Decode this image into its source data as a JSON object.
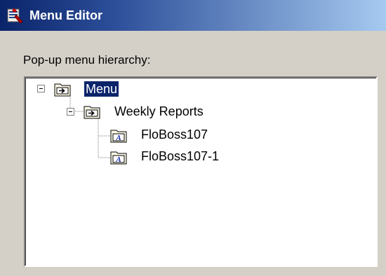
{
  "window": {
    "title": "Menu Editor",
    "icon": "menu-editor-app-icon"
  },
  "tree_group": {
    "label": "Pop-up menu hierarchy:"
  },
  "tree": {
    "nodes": [
      {
        "label": "Menu",
        "icon": "menu-folder-icon",
        "expanded": true,
        "selected": true
      },
      {
        "label": "Weekly Reports",
        "icon": "menu-folder-icon",
        "expanded": true,
        "selected": false
      },
      {
        "label": "FloBoss107",
        "icon": "report-folder-icon",
        "selected": false
      },
      {
        "label": "FloBoss107-1",
        "icon": "report-folder-icon",
        "selected": false
      }
    ]
  },
  "colors": {
    "selection_bg": "#0a246a",
    "titlebar_start": "#0a246a",
    "titlebar_end": "#a6caf0",
    "dialog_face": "#d4d0c8"
  }
}
